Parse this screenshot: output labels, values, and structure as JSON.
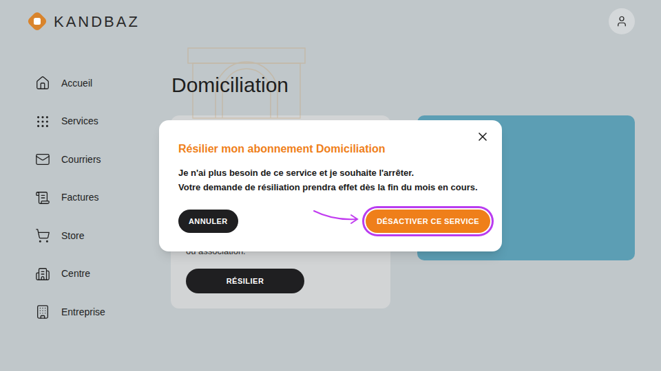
{
  "logo": {
    "text": "KANDBAZ"
  },
  "sidebar": {
    "items": [
      {
        "label": "Accueil"
      },
      {
        "label": "Services"
      },
      {
        "label": "Courriers"
      },
      {
        "label": "Factures"
      },
      {
        "label": "Store"
      },
      {
        "label": "Centre"
      },
      {
        "label": "Entreprise"
      }
    ]
  },
  "page": {
    "title": "Domiciliation",
    "card": {
      "text": "ou association.",
      "button": "RÉSILIER"
    }
  },
  "modal": {
    "title": "Résilier mon abonnement Domiciliation",
    "lines": [
      "Je n'ai plus besoin de ce service et je souhaite l'arrêter.",
      "Votre demande de résiliation prendra effet dès la fin du mois en cours."
    ],
    "buttons": [
      {
        "label": "ANNULER",
        "highlighted": false
      },
      {
        "label": "DÉSACTIVER CE SERVICE",
        "highlighted": true
      }
    ]
  }
}
